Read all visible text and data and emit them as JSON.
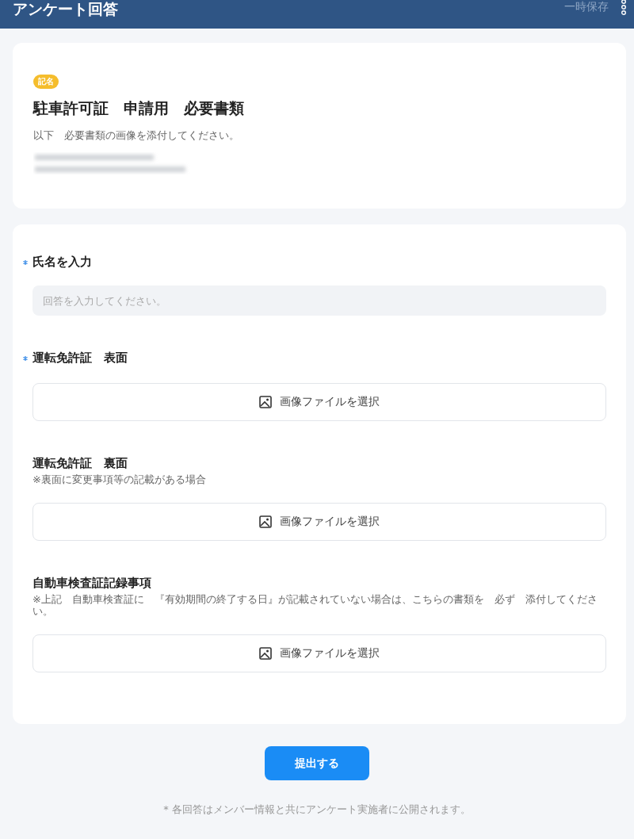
{
  "header": {
    "title": "アンケート回答",
    "save_label": "一時保存"
  },
  "intro": {
    "badge": "記名",
    "title": "駐車許可証　申請用　必要書類",
    "description": "以下　必要書類の画像を添付してください。"
  },
  "questions": [
    {
      "kind": "text",
      "label": "氏名を入力",
      "required": true,
      "placeholder": "回答を入力してください。"
    },
    {
      "kind": "image",
      "label": "運転免許証　表面",
      "required": true,
      "button": "画像ファイルを選択"
    },
    {
      "kind": "image",
      "label": "運転免許証　裏面",
      "required": false,
      "note": "※裏面に変更事項等の記載がある場合",
      "button": "画像ファイルを選択"
    },
    {
      "kind": "image",
      "label": "自動車検査証記録事項",
      "required": false,
      "note": "※上記　自動車検査証に　『有効期間の終了する日』が記載されていない場合は、こちらの書類を　必ず　添付してください。",
      "button": "画像ファイルを選択"
    }
  ],
  "submit": "提出する",
  "footer": "* 各回答はメンバー情報と共にアンケート実施者に公開されます。"
}
